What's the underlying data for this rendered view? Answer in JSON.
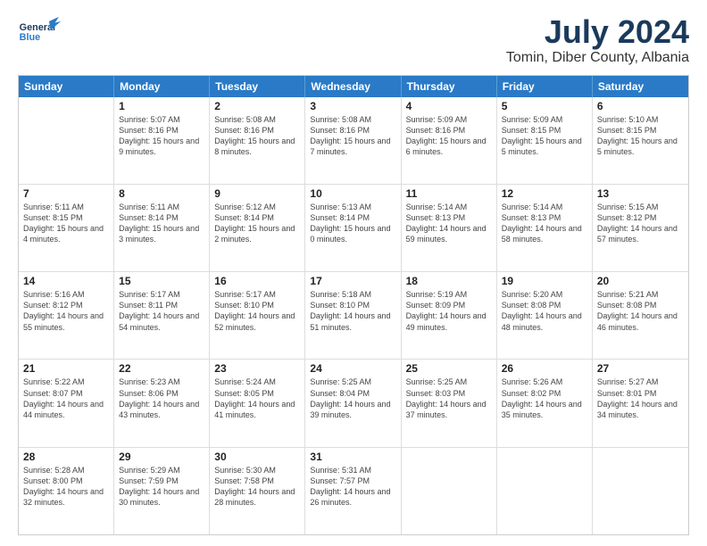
{
  "header": {
    "logo_general": "General",
    "logo_blue": "Blue",
    "title": "July 2024",
    "subtitle": "Tomin, Diber County, Albania"
  },
  "day_names": [
    "Sunday",
    "Monday",
    "Tuesday",
    "Wednesday",
    "Thursday",
    "Friday",
    "Saturday"
  ],
  "weeks": [
    [
      {
        "day": "",
        "sunrise": "",
        "sunset": "",
        "daylight": ""
      },
      {
        "day": "1",
        "sunrise": "Sunrise: 5:07 AM",
        "sunset": "Sunset: 8:16 PM",
        "daylight": "Daylight: 15 hours and 9 minutes."
      },
      {
        "day": "2",
        "sunrise": "Sunrise: 5:08 AM",
        "sunset": "Sunset: 8:16 PM",
        "daylight": "Daylight: 15 hours and 8 minutes."
      },
      {
        "day": "3",
        "sunrise": "Sunrise: 5:08 AM",
        "sunset": "Sunset: 8:16 PM",
        "daylight": "Daylight: 15 hours and 7 minutes."
      },
      {
        "day": "4",
        "sunrise": "Sunrise: 5:09 AM",
        "sunset": "Sunset: 8:16 PM",
        "daylight": "Daylight: 15 hours and 6 minutes."
      },
      {
        "day": "5",
        "sunrise": "Sunrise: 5:09 AM",
        "sunset": "Sunset: 8:15 PM",
        "daylight": "Daylight: 15 hours and 5 minutes."
      },
      {
        "day": "6",
        "sunrise": "Sunrise: 5:10 AM",
        "sunset": "Sunset: 8:15 PM",
        "daylight": "Daylight: 15 hours and 5 minutes."
      }
    ],
    [
      {
        "day": "7",
        "sunrise": "Sunrise: 5:11 AM",
        "sunset": "Sunset: 8:15 PM",
        "daylight": "Daylight: 15 hours and 4 minutes."
      },
      {
        "day": "8",
        "sunrise": "Sunrise: 5:11 AM",
        "sunset": "Sunset: 8:14 PM",
        "daylight": "Daylight: 15 hours and 3 minutes."
      },
      {
        "day": "9",
        "sunrise": "Sunrise: 5:12 AM",
        "sunset": "Sunset: 8:14 PM",
        "daylight": "Daylight: 15 hours and 2 minutes."
      },
      {
        "day": "10",
        "sunrise": "Sunrise: 5:13 AM",
        "sunset": "Sunset: 8:14 PM",
        "daylight": "Daylight: 15 hours and 0 minutes."
      },
      {
        "day": "11",
        "sunrise": "Sunrise: 5:14 AM",
        "sunset": "Sunset: 8:13 PM",
        "daylight": "Daylight: 14 hours and 59 minutes."
      },
      {
        "day": "12",
        "sunrise": "Sunrise: 5:14 AM",
        "sunset": "Sunset: 8:13 PM",
        "daylight": "Daylight: 14 hours and 58 minutes."
      },
      {
        "day": "13",
        "sunrise": "Sunrise: 5:15 AM",
        "sunset": "Sunset: 8:12 PM",
        "daylight": "Daylight: 14 hours and 57 minutes."
      }
    ],
    [
      {
        "day": "14",
        "sunrise": "Sunrise: 5:16 AM",
        "sunset": "Sunset: 8:12 PM",
        "daylight": "Daylight: 14 hours and 55 minutes."
      },
      {
        "day": "15",
        "sunrise": "Sunrise: 5:17 AM",
        "sunset": "Sunset: 8:11 PM",
        "daylight": "Daylight: 14 hours and 54 minutes."
      },
      {
        "day": "16",
        "sunrise": "Sunrise: 5:17 AM",
        "sunset": "Sunset: 8:10 PM",
        "daylight": "Daylight: 14 hours and 52 minutes."
      },
      {
        "day": "17",
        "sunrise": "Sunrise: 5:18 AM",
        "sunset": "Sunset: 8:10 PM",
        "daylight": "Daylight: 14 hours and 51 minutes."
      },
      {
        "day": "18",
        "sunrise": "Sunrise: 5:19 AM",
        "sunset": "Sunset: 8:09 PM",
        "daylight": "Daylight: 14 hours and 49 minutes."
      },
      {
        "day": "19",
        "sunrise": "Sunrise: 5:20 AM",
        "sunset": "Sunset: 8:08 PM",
        "daylight": "Daylight: 14 hours and 48 minutes."
      },
      {
        "day": "20",
        "sunrise": "Sunrise: 5:21 AM",
        "sunset": "Sunset: 8:08 PM",
        "daylight": "Daylight: 14 hours and 46 minutes."
      }
    ],
    [
      {
        "day": "21",
        "sunrise": "Sunrise: 5:22 AM",
        "sunset": "Sunset: 8:07 PM",
        "daylight": "Daylight: 14 hours and 44 minutes."
      },
      {
        "day": "22",
        "sunrise": "Sunrise: 5:23 AM",
        "sunset": "Sunset: 8:06 PM",
        "daylight": "Daylight: 14 hours and 43 minutes."
      },
      {
        "day": "23",
        "sunrise": "Sunrise: 5:24 AM",
        "sunset": "Sunset: 8:05 PM",
        "daylight": "Daylight: 14 hours and 41 minutes."
      },
      {
        "day": "24",
        "sunrise": "Sunrise: 5:25 AM",
        "sunset": "Sunset: 8:04 PM",
        "daylight": "Daylight: 14 hours and 39 minutes."
      },
      {
        "day": "25",
        "sunrise": "Sunrise: 5:25 AM",
        "sunset": "Sunset: 8:03 PM",
        "daylight": "Daylight: 14 hours and 37 minutes."
      },
      {
        "day": "26",
        "sunrise": "Sunrise: 5:26 AM",
        "sunset": "Sunset: 8:02 PM",
        "daylight": "Daylight: 14 hours and 35 minutes."
      },
      {
        "day": "27",
        "sunrise": "Sunrise: 5:27 AM",
        "sunset": "Sunset: 8:01 PM",
        "daylight": "Daylight: 14 hours and 34 minutes."
      }
    ],
    [
      {
        "day": "28",
        "sunrise": "Sunrise: 5:28 AM",
        "sunset": "Sunset: 8:00 PM",
        "daylight": "Daylight: 14 hours and 32 minutes."
      },
      {
        "day": "29",
        "sunrise": "Sunrise: 5:29 AM",
        "sunset": "Sunset: 7:59 PM",
        "daylight": "Daylight: 14 hours and 30 minutes."
      },
      {
        "day": "30",
        "sunrise": "Sunrise: 5:30 AM",
        "sunset": "Sunset: 7:58 PM",
        "daylight": "Daylight: 14 hours and 28 minutes."
      },
      {
        "day": "31",
        "sunrise": "Sunrise: 5:31 AM",
        "sunset": "Sunset: 7:57 PM",
        "daylight": "Daylight: 14 hours and 26 minutes."
      },
      {
        "day": "",
        "sunrise": "",
        "sunset": "",
        "daylight": ""
      },
      {
        "day": "",
        "sunrise": "",
        "sunset": "",
        "daylight": ""
      },
      {
        "day": "",
        "sunrise": "",
        "sunset": "",
        "daylight": ""
      }
    ]
  ]
}
